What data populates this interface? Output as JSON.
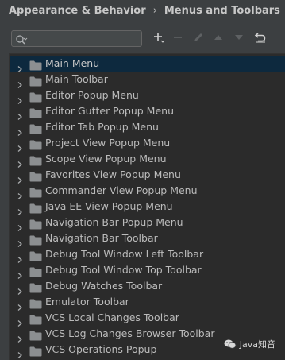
{
  "breadcrumb": {
    "parent": "Appearance & Behavior",
    "separator": "›",
    "current": "Menus and Toolbars"
  },
  "search": {
    "value": "",
    "placeholder": ""
  },
  "toolbar": {
    "icons": [
      "add-icon",
      "remove-icon",
      "edit-icon",
      "move-up-icon",
      "move-down-icon",
      "restore-icon"
    ]
  },
  "tree": {
    "selected_index": 0,
    "items": [
      {
        "label": "Main Menu"
      },
      {
        "label": "Main Toolbar"
      },
      {
        "label": "Editor Popup Menu"
      },
      {
        "label": "Editor Gutter Popup Menu"
      },
      {
        "label": "Editor Tab Popup Menu"
      },
      {
        "label": "Project View Popup Menu"
      },
      {
        "label": "Scope View Popup Menu"
      },
      {
        "label": "Favorites View Popup Menu"
      },
      {
        "label": "Commander View Popup Menu"
      },
      {
        "label": "Java EE View Popup Menu"
      },
      {
        "label": "Navigation Bar Popup Menu"
      },
      {
        "label": "Navigation Bar Toolbar"
      },
      {
        "label": "Debug Tool Window Left Toolbar"
      },
      {
        "label": "Debug Tool Window Top Toolbar"
      },
      {
        "label": "Debug Watches Toolbar"
      },
      {
        "label": "Emulator Toolbar"
      },
      {
        "label": "VCS Local Changes Toolbar"
      },
      {
        "label": "VCS Log Changes Browser Toolbar"
      },
      {
        "label": "VCS Operations Popup"
      }
    ]
  },
  "watermark": {
    "text": "Java知音"
  },
  "colors": {
    "background": "#3c3f41",
    "tree_background": "#2b2b2b",
    "selection": "#0d293e",
    "text": "#bbbbbb",
    "folder": "#8c8f91"
  }
}
